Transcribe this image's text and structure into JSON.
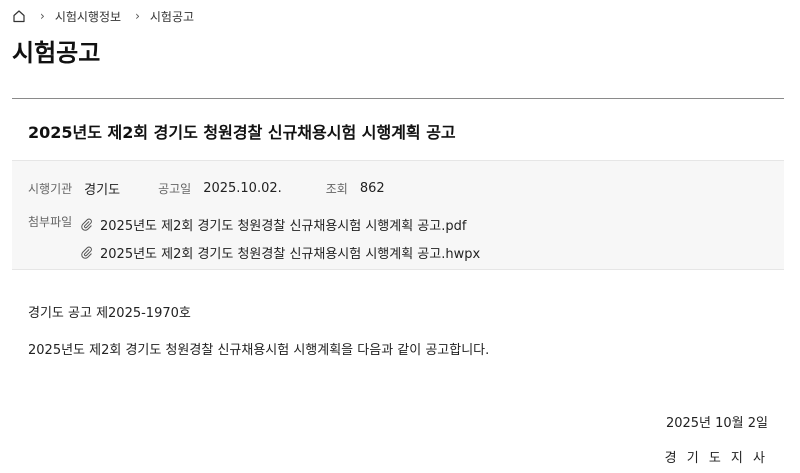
{
  "breadcrumb": {
    "home_icon": "home-icon",
    "items": [
      "시험시행정보",
      "시험공고"
    ]
  },
  "page": {
    "title": "시험공고"
  },
  "notice": {
    "title": "2025년도 제2회 경기도 청원경찰 신규채용시험 시행계획 공고",
    "meta": {
      "agency_label": "시행기관",
      "agency_value": "경기도",
      "date_label": "공고일",
      "date_value": "2025.10.02.",
      "views_label": "조회",
      "views_value": "862"
    },
    "attachments_label": "첨부파일",
    "attachments": [
      "2025년도 제2회 경기도 청원경찰 신규채용시험 시행계획 공고.pdf",
      "2025년도 제2회 경기도 청원경찰 신규채용시험 시행계획 공고.hwpx"
    ],
    "attachment_icon": "paperclip-icon",
    "body": {
      "notice_number": "경기도 공고 제2025-1970호",
      "text": "2025년도 제2회 경기도 청원경찰 신규채용시험 시행계획을 다음과 같이 공고합니다."
    },
    "date": "2025년 10월 2일",
    "signer": "경 기 도 지 사"
  },
  "colors": {
    "divider": "#8a8a8a",
    "meta_background": "#f7f7f7",
    "text": "#222222"
  }
}
